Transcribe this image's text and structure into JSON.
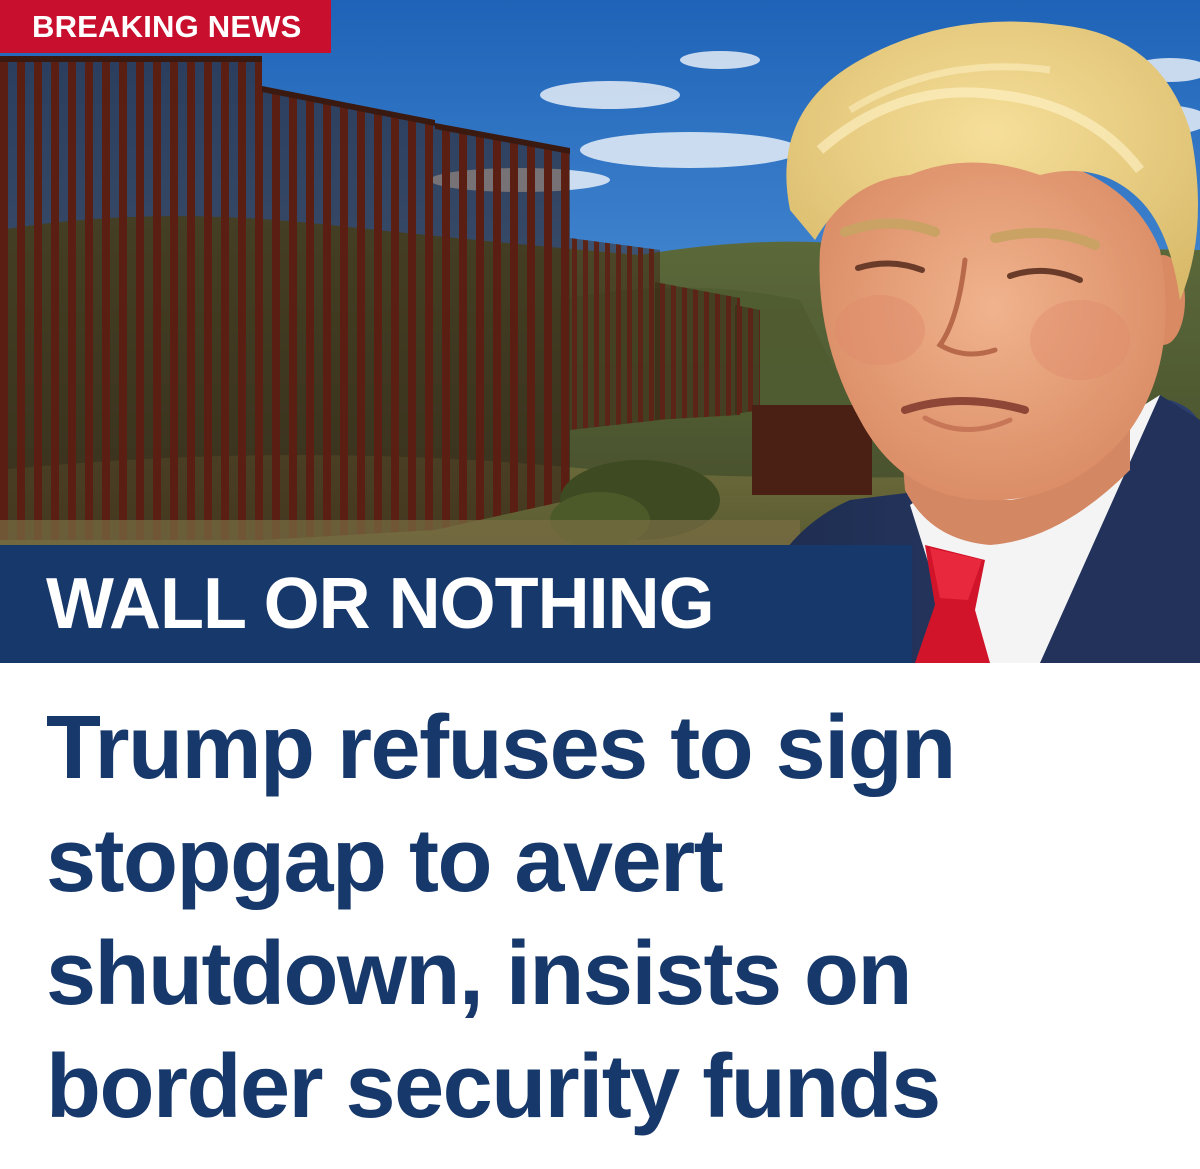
{
  "badge": {
    "label": "BREAKING NEWS",
    "background": "#c8102e"
  },
  "banner": {
    "label": "WALL OR NOTHING",
    "background": "#17386b"
  },
  "headline": {
    "lines": [
      "Trump refuses to sign",
      "stopgap to avert",
      "shutdown, insists on",
      "border security funds"
    ],
    "color": "#17386b"
  },
  "photo": {
    "subjects": [
      "border-wall",
      "sky",
      "hills",
      "man-portrait"
    ]
  }
}
